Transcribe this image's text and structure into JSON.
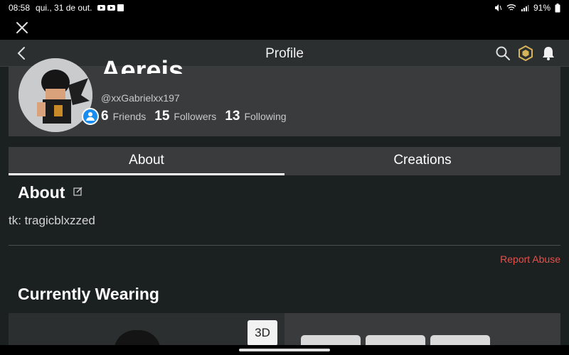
{
  "status_bar": {
    "time": "08:58",
    "date": "qui., 31 de out.",
    "battery": "91%"
  },
  "nav": {
    "title": "Profile",
    "icons": [
      "close-icon",
      "back-icon",
      "search-icon",
      "robux-icon",
      "notification-bell-icon"
    ]
  },
  "profile": {
    "display_name": "Aereis",
    "username": "@xxGabrielxx197",
    "stats": [
      {
        "count": "6",
        "label": "Friends"
      },
      {
        "count": "15",
        "label": "Followers"
      },
      {
        "count": "13",
        "label": "Following"
      }
    ]
  },
  "tabs": [
    {
      "label": "About",
      "active": true
    },
    {
      "label": "Creations",
      "active": false
    }
  ],
  "about": {
    "heading": "About",
    "bio": "tk: tragicblxzzed",
    "report_label": "Report Abuse"
  },
  "wearing": {
    "heading": "Currently Wearing",
    "view_toggle": "3D"
  },
  "colors": {
    "background": "#1b2121",
    "card": "#393b3d",
    "report": "#e5504b",
    "badge": "#1a8ef0"
  }
}
